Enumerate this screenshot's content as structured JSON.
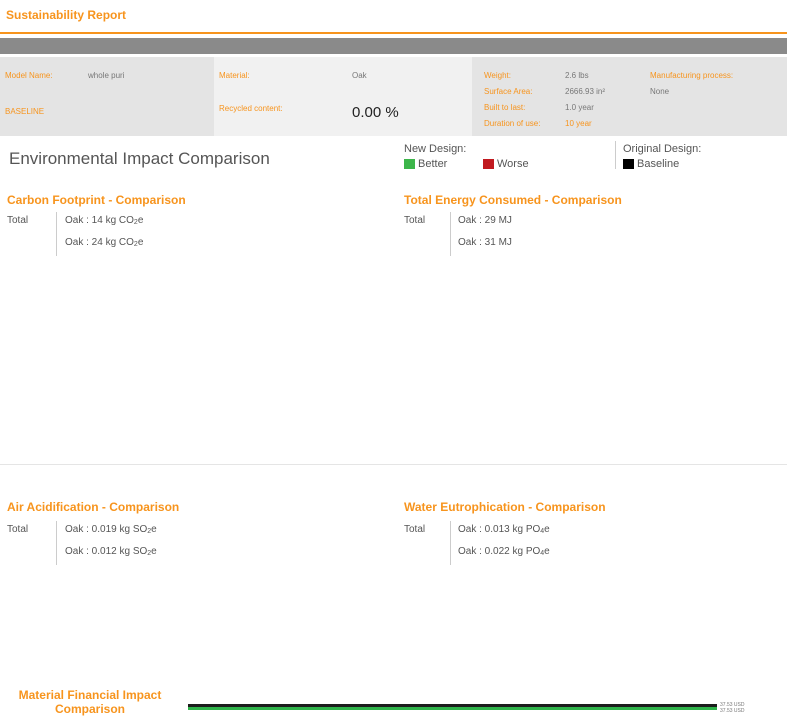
{
  "header": {
    "title": "Sustainability Report"
  },
  "info": {
    "model_name_label": "Model Name:",
    "model_name_value": "whole puri",
    "baseline_label": "BASELINE",
    "material_label": "Material:",
    "material_value": "Oak",
    "recycled_label": "Recycled content:",
    "recycled_value": "0.00 %",
    "weight_label": "Weight:",
    "weight_value": "2.6 lbs",
    "surface_label": "Surface Area:",
    "surface_value": "2666.93 in²",
    "built_label": "Built to last:",
    "built_value": "1.0 year",
    "duration_label": "Duration of use:",
    "duration_value": "10 year",
    "manufacturing_label": "Manufacturing process:",
    "manufacturing_value": "None"
  },
  "impact": {
    "title": "Environmental Impact Comparison",
    "new_design_label": "New Design:",
    "better_label": "Better",
    "worse_label": "Worse",
    "original_design_label": "Original Design:",
    "baseline_label": "Baseline",
    "colors": {
      "better": "#3cb54a",
      "worse": "#c1191f",
      "baseline": "#000000",
      "accent": "#f7941d"
    }
  },
  "sections": {
    "carbon": {
      "title": "Carbon Footprint - Comparison",
      "total_label": "Total",
      "row1_prefix": "Oak : 14 kg CO",
      "row1_sub": "2",
      "row1_suffix": "e",
      "row2_prefix": "Oak : 24 kg CO",
      "row2_sub": "2",
      "row2_suffix": "e"
    },
    "energy": {
      "title": "Total Energy Consumed - Comparison",
      "total_label": "Total",
      "row1": "Oak : 29 MJ",
      "row2": "Oak : 31 MJ"
    },
    "air": {
      "title": "Air Acidification - Comparison",
      "total_label": "Total",
      "row1_prefix": "Oak : 0.019 kg SO",
      "row1_sub": "2",
      "row1_suffix": "e",
      "row2_prefix": "Oak : 0.012 kg SO",
      "row2_sub": "2",
      "row2_suffix": "e"
    },
    "water": {
      "title": "Water Eutrophication - Comparison",
      "total_label": "Total",
      "row1_prefix": "Oak : 0.013 kg PO",
      "row1_sub": "4",
      "row1_suffix": "e",
      "row2_prefix": "Oak : 0.022 kg PO",
      "row2_sub": "4",
      "row2_suffix": "e"
    }
  },
  "financial": {
    "title_line1": "Material Financial Impact",
    "title_line2": "Comparison",
    "value1": "37.53 USD",
    "value2": "37.53 USD"
  }
}
